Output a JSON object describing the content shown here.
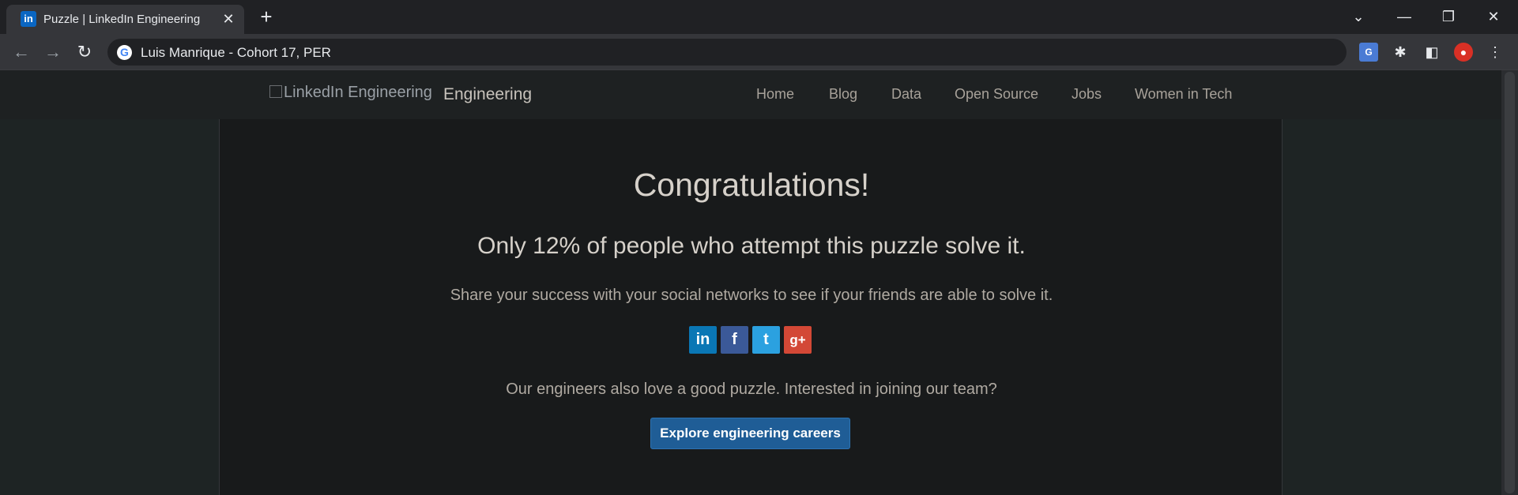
{
  "browser": {
    "tab_title": "Puzzle | LinkedIn Engineering",
    "tab_favicon": "in",
    "url": "Luis Manrique - Cohort 17, PER",
    "translate_label": "G"
  },
  "site": {
    "logo_alt": "LinkedIn Engineering",
    "logo_text": "Engineering",
    "nav": [
      "Home",
      "Blog",
      "Data",
      "Open Source",
      "Jobs",
      "Women in Tech"
    ]
  },
  "main": {
    "heading": "Congratulations!",
    "subheading": "Only 12% of people who attempt this puzzle solve it.",
    "share_text": "Share your success with your social networks to see if your friends are able to solve it.",
    "share_icons": {
      "linkedin": "in",
      "facebook": "f",
      "twitter": "t",
      "googleplus": "g+"
    },
    "careers_text": "Our engineers also love a good puzzle. Interested in joining our team?",
    "cta_label": "Explore engineering careers"
  },
  "colors": {
    "cta": "#1f5d96",
    "linkedin": "#0a77b5",
    "facebook": "#3b5998",
    "twitter": "#2ba1e0",
    "googleplus": "#d34836"
  }
}
